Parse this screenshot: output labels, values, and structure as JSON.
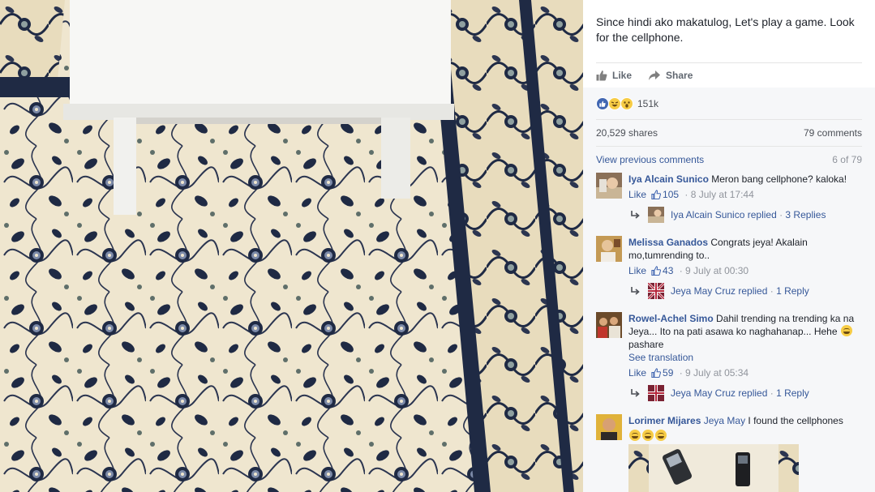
{
  "post": {
    "text": "Since hindi ako makatulog, Let's play a game. Look for the cellphone.",
    "like_label": "Like",
    "share_label": "Share",
    "reaction_count": "151k",
    "shares": "20,529 shares",
    "comments_count": "79 comments"
  },
  "comments_section": {
    "view_previous": "View previous comments",
    "pager": "6 of 79"
  },
  "comments": [
    {
      "name": "Iya Alcain Sunico",
      "text": "Meron bang cellphone? kaloka!",
      "like_label": "Like",
      "likes": "105",
      "time": "8 July at 17:44",
      "reply_author": "Iya Alcain Sunico replied",
      "reply_count": "3 Replies"
    },
    {
      "name": "Melissa Ganados",
      "text": "Congrats jeya! Akalain mo,tumrending to..",
      "like_label": "Like",
      "likes": "43",
      "time": "9 July at 00:30",
      "reply_author": "Jeya May Cruz replied",
      "reply_count": "1 Reply"
    },
    {
      "name": "Rowel-Achel Simo",
      "text": "Dahil trending na trending ka na Jeya... Ito na pati asawa ko naghahanap... Hehe",
      "text_after_emoji": "pashare",
      "see_translation": "See translation",
      "like_label": "Like",
      "likes": "59",
      "time": "9 July at 05:34",
      "reply_author": "Jeya May Cruz replied",
      "reply_count": "1 Reply"
    },
    {
      "name": "Lorimer Mijares",
      "mention": "Jeya May",
      "text": "I found the cellphones"
    }
  ],
  "colors": {
    "link": "#365899",
    "text": "#1d2129",
    "muted": "#90949c",
    "like_blue": "#4267b2",
    "rug_cream": "#efe6cf",
    "rug_navy": "#1f2a44"
  }
}
